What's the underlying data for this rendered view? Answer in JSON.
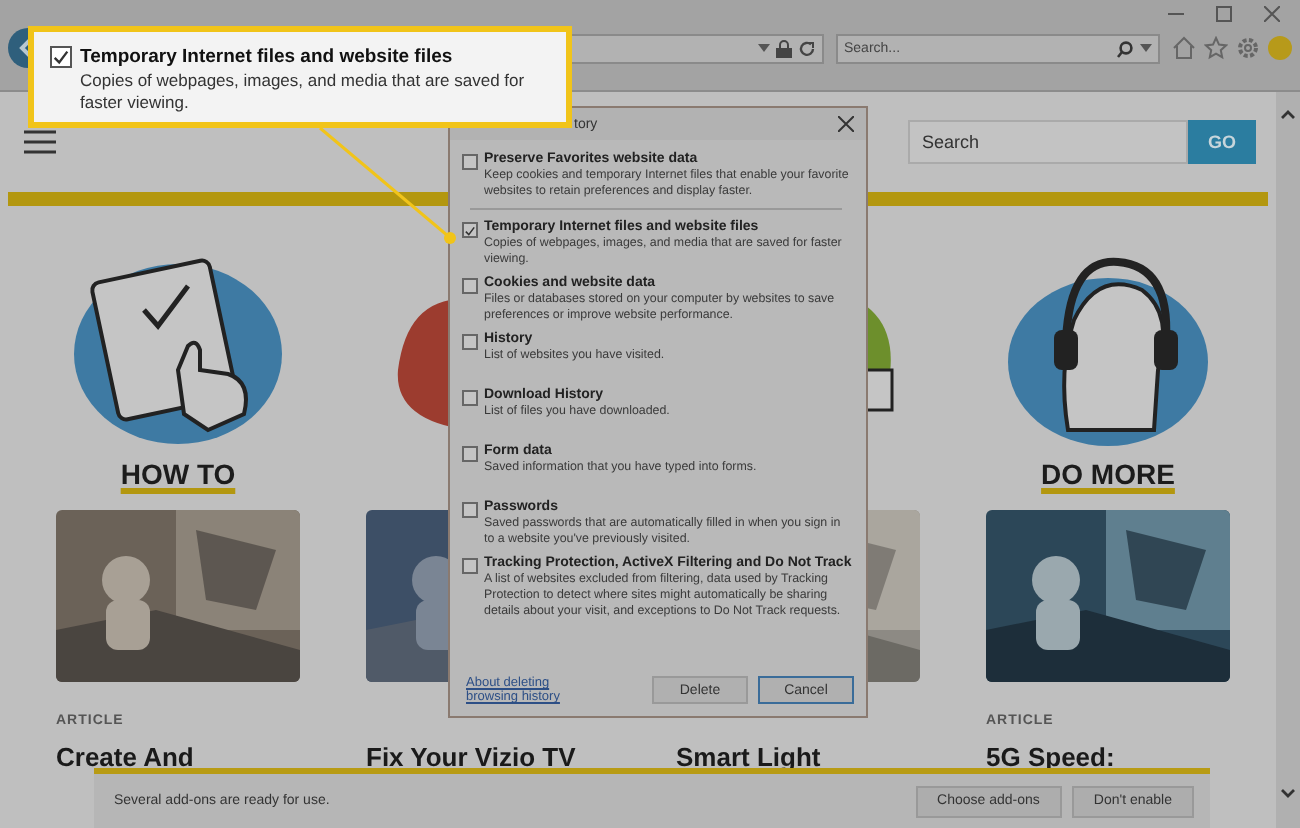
{
  "browser": {
    "search_placeholder": "Search..."
  },
  "page": {
    "search_placeholder": "Search",
    "go_label": "GO",
    "columns": [
      {
        "category": "HOW TO",
        "kind": "tablet",
        "kicker": "ARTICLE",
        "title": "Create And"
      },
      {
        "kind": "warm",
        "title": "Fix Your Vizio TV"
      },
      {
        "kind": "leaf",
        "title": "Smart Light"
      },
      {
        "category": "DO MORE",
        "kind": "headphones",
        "kicker": "ARTICLE",
        "title": "5G Speed:"
      }
    ]
  },
  "dialog": {
    "title": "tory",
    "options": [
      {
        "label": "Preserve Favorites website data",
        "description": "Keep cookies and temporary Internet files that enable your favorite websites to retain preferences and display faster.",
        "checked": false
      },
      {
        "label": "Temporary Internet files and website files",
        "description": "Copies of webpages, images, and media that are saved for faster viewing.",
        "checked": true
      },
      {
        "label": "Cookies and website data",
        "description": "Files or databases stored on your computer by websites to save preferences or improve website performance.",
        "checked": false
      },
      {
        "label": "History",
        "description": "List of websites you have visited.",
        "checked": false
      },
      {
        "label": "Download History",
        "description": "List of files you have downloaded.",
        "checked": false
      },
      {
        "label": "Form data",
        "description": "Saved information that you have typed into forms.",
        "checked": false
      },
      {
        "label": "Passwords",
        "description": "Saved passwords that are automatically filled in when you sign in to a website you've previously visited.",
        "checked": false
      },
      {
        "label": "Tracking Protection, ActiveX Filtering and Do Not Track",
        "description": "A list of websites excluded from filtering, data used by Tracking Protection to detect where sites might automatically be sharing details about your visit, and exceptions to Do Not Track requests.",
        "checked": false
      }
    ],
    "link": "About deleting browsing history",
    "buttons": [
      {
        "label": "Delete",
        "default": false
      },
      {
        "label": "Cancel",
        "default": true
      }
    ]
  },
  "callout": {
    "label": "Temporary Internet files and website files",
    "description": "Copies of webpages, images, and media that are saved for faster viewing.",
    "checked": true
  },
  "notification": {
    "message": "Several add-ons are ready for use.",
    "buttons": [
      "Choose add-ons",
      "Don't enable"
    ]
  }
}
